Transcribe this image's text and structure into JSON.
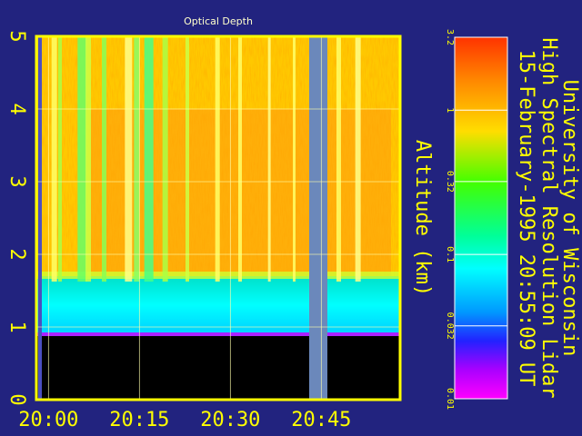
{
  "chart_data": {
    "type": "heatmap",
    "title": "Optical Depth",
    "ylabel": "Altitude (km)",
    "xlabel": "",
    "x_ticks": [
      "20:00",
      "20:15",
      "20:30",
      "20:45"
    ],
    "y_ticks": [
      "0",
      "1",
      "2",
      "3",
      "4",
      "5"
    ],
    "ylim": [
      0,
      5
    ],
    "xlim": [
      "19:58",
      "20:58"
    ],
    "grid": true,
    "colorbar": {
      "scale": "log",
      "ticks": [
        "3.2",
        "1",
        "0.32",
        "0.1",
        "0.032",
        "0.01"
      ],
      "range": [
        0.01,
        3.2
      ]
    },
    "features": {
      "cloud_base_km": 1.7,
      "boundary_layer_top_km": 0.9,
      "data_gap_start": "20:43",
      "data_gap_end": "20:46"
    }
  },
  "side_text": {
    "line1": "University of Wisconsin",
    "line2": "High Spectral Resolution Lidar",
    "line3": "15-February-1995 20:55:09 UT"
  },
  "colors": {
    "background": "#22237f",
    "frame": "#ffff00",
    "text": "#ffff00",
    "title_text": "#ffffcc"
  }
}
